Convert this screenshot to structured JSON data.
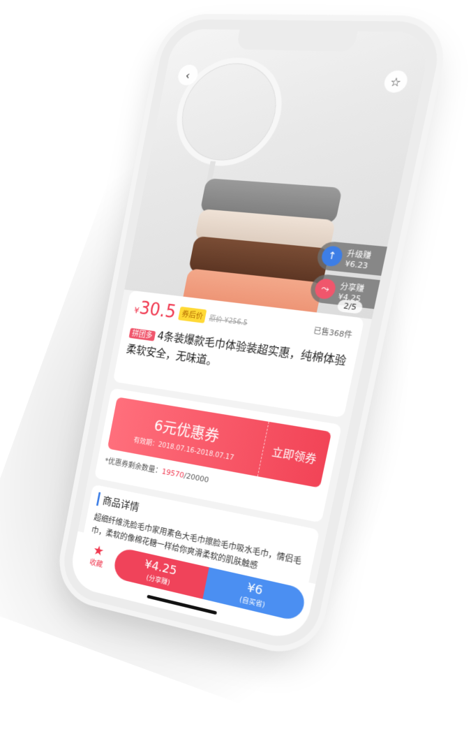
{
  "nav": {
    "back_icon": "‹",
    "fav_icon": "☆"
  },
  "earn": [
    {
      "label": "升级赚",
      "value": "¥6.23"
    },
    {
      "label": "分享赚",
      "value": "¥4.25"
    }
  ],
  "pager": "2/5",
  "product": {
    "currency": "¥",
    "price": "30.5",
    "after_coupon_tag": "券后价",
    "original_price": "原价 ¥256.5",
    "sold": "已售368件",
    "platform_tag": "拼团多",
    "title": "4条装爆款毛巾体验装超实惠，纯棉体验柔软安全，无味道。"
  },
  "coupon": {
    "amount": "6元优惠券",
    "valid": "有效期：2018.07.16-2018.07.17",
    "action": "立即领券",
    "remain_label": "*优惠券剩余数量：",
    "remain_count": "19570",
    "remain_total": "/20000"
  },
  "detail": {
    "title": "商品详情",
    "text": "超细纤维洗脸毛巾家用素色大毛巾擦脸毛巾吸水毛巾，情侣毛巾，柔软的像棉花糖一样给你爽滑柔软的肌肤触感"
  },
  "bottom": {
    "fav_label": "收藏",
    "share_price": "¥4.25",
    "share_label": "(分享赚)",
    "buy_price": "¥6",
    "buy_label": "(自买省)"
  },
  "colors": {
    "accent_red": "#f0384f",
    "accent_blue": "#4b8ff2",
    "tag_yellow": "#ffd936"
  }
}
